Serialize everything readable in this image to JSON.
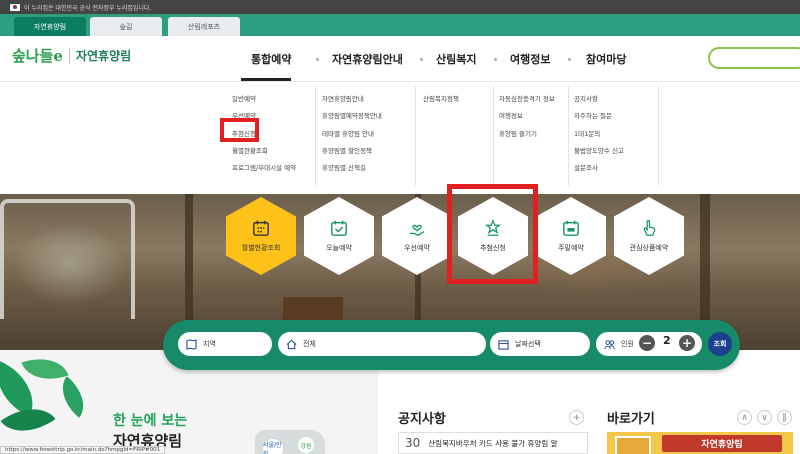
{
  "gov_banner": {
    "text": "이 누리집은 대한민국 공식 전자정부 누리집입니다."
  },
  "site_tabs": [
    "자연휴양림",
    "숲길",
    "산림레포츠"
  ],
  "header": {
    "logo_text": "숲나들e",
    "site_name": "자연휴양림",
    "gnb": [
      "통합예약",
      "자연휴양림안내",
      "산림복지",
      "여행정보",
      "참여마당"
    ]
  },
  "mega_menu": {
    "col1": [
      "일반예약",
      "우선예약",
      "추첨신청",
      "월별현황조회",
      "프로그램/부대시설 예약"
    ],
    "col2": [
      "자연휴양림안내",
      "휴양림별예약정책안내",
      "테마별 휴양림 안내",
      "휴양림별 할인정책",
      "휴양림별 산책길"
    ],
    "col3": [
      "산림복지정책"
    ],
    "col4": [
      "자동심장충격기 정보",
      "여행정보",
      "휴양림 즐기기"
    ],
    "col5": [
      "공지사항",
      "자주하는 질문",
      "1대1문의",
      "불법양도양수 신고",
      "설문조사"
    ]
  },
  "quick_menu": [
    "월별현황조회",
    "오늘예약",
    "우선예약",
    "추첨신청",
    "주말예약",
    "관심상품예약"
  ],
  "search_bar": {
    "region": "지역",
    "type": "전체",
    "date": "날짜선택",
    "people_label": "인원",
    "people_count": "2",
    "minus": "−",
    "plus": "+",
    "submit": "조회"
  },
  "intro": {
    "line1": "한 눈에 보는",
    "line2": "자연휴양림",
    "map_labels": [
      "서울/인천",
      "강원"
    ]
  },
  "notice": {
    "title": "공지사항",
    "more": "+",
    "date_day": "30",
    "headline": "산림복지바우처 카드 사용 불가 휴양림 알"
  },
  "shortcut": {
    "title": "바로가기",
    "banner_label": "자연휴양림",
    "controls": [
      "∧",
      "∨",
      "‖"
    ]
  },
  "status_url": "https://www.foresttrip.go.kr/main.do?hmpgId=FRIP#001",
  "colors": {
    "brand_green": "#178a6a",
    "highlight_red": "#e32020",
    "active_yellow": "#ffc21a",
    "submit_blue": "#1c3f8f"
  }
}
